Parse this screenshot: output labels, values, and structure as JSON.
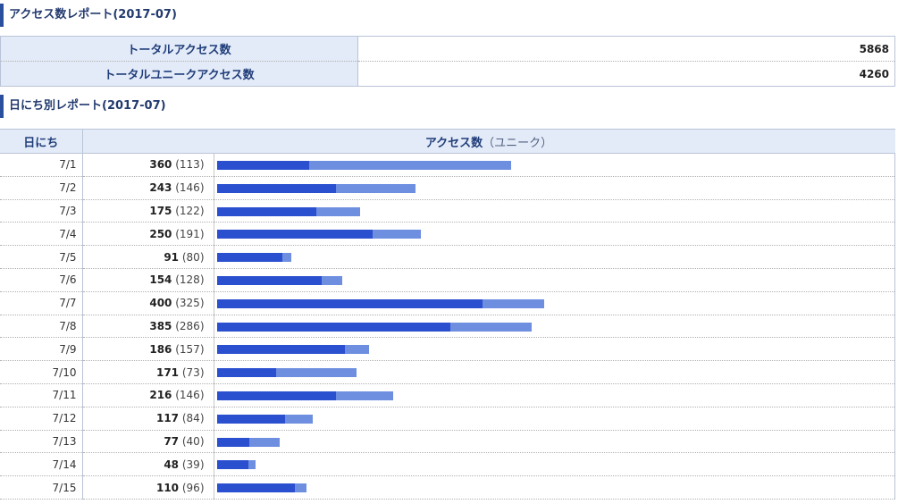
{
  "summary": {
    "title": "アクセス数レポート(2017-07)",
    "rows": [
      {
        "label": "トータルアクセス数",
        "value": "5868"
      },
      {
        "label": "トータルユニークアクセス数",
        "value": "4260"
      }
    ]
  },
  "daily": {
    "title": "日にち別レポート(2017-07)",
    "col_day": "日にち",
    "col_access": "アクセス数",
    "col_access_unique": "（ユニーク）"
  },
  "colors": {
    "total": "#6e8ee0",
    "unique": "#2a4fcf"
  },
  "chart_data": {
    "type": "bar",
    "orientation": "horizontal",
    "title": "日にち別レポート(2017-07)",
    "categories": [
      "7/1",
      "7/2",
      "7/3",
      "7/4",
      "7/5",
      "7/6",
      "7/7",
      "7/8",
      "7/9",
      "7/10",
      "7/11",
      "7/12",
      "7/13",
      "7/14",
      "7/15"
    ],
    "series": [
      {
        "name": "アクセス数",
        "values": [
          360,
          243,
          175,
          250,
          91,
          154,
          400,
          385,
          186,
          171,
          216,
          117,
          77,
          48,
          110
        ]
      },
      {
        "name": "ユニーク",
        "values": [
          113,
          146,
          122,
          191,
          80,
          128,
          325,
          286,
          157,
          73,
          146,
          84,
          40,
          39,
          96
        ]
      }
    ],
    "xlim": [
      0,
      400
    ],
    "grid": false
  }
}
